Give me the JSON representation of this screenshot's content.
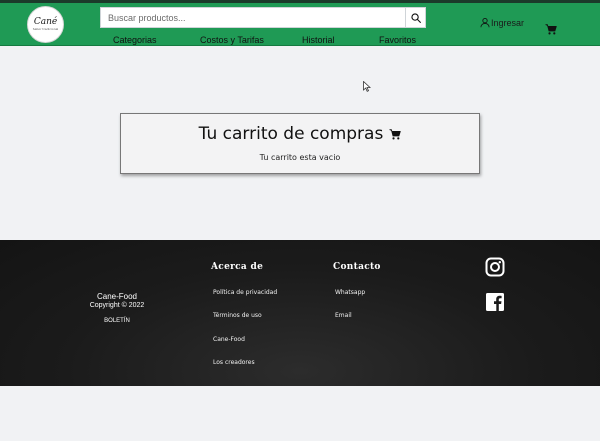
{
  "header": {
    "logo_text": "Cané",
    "logo_subtext": "Sabor tradicional",
    "search": {
      "placeholder": "Buscar productos..."
    },
    "login_label": "Ingresar",
    "nav": [
      "Categorias",
      "Costos y Tarifas",
      "Historial",
      "Favoritos"
    ],
    "colors": {
      "bar": "#1f9a55",
      "top_line": "#1b3a2a"
    }
  },
  "cart": {
    "title": "Tu carrito de compras",
    "empty_message": "Tu carrito esta vacio"
  },
  "footer": {
    "brand_name": "Cane-Food",
    "copyright": "Copyright © 2022",
    "newsletter": "BOLETÍN",
    "about": {
      "heading": "Acerca de",
      "links": [
        "Política de privacidad",
        "Términos de uso",
        "Cane-Food",
        "Los creadores"
      ]
    },
    "contact": {
      "heading": "Contacto",
      "links": [
        "Whatsapp",
        "Email"
      ]
    },
    "social_icons": [
      "instagram-icon",
      "facebook-icon"
    ],
    "background": "#1b1b1b"
  }
}
